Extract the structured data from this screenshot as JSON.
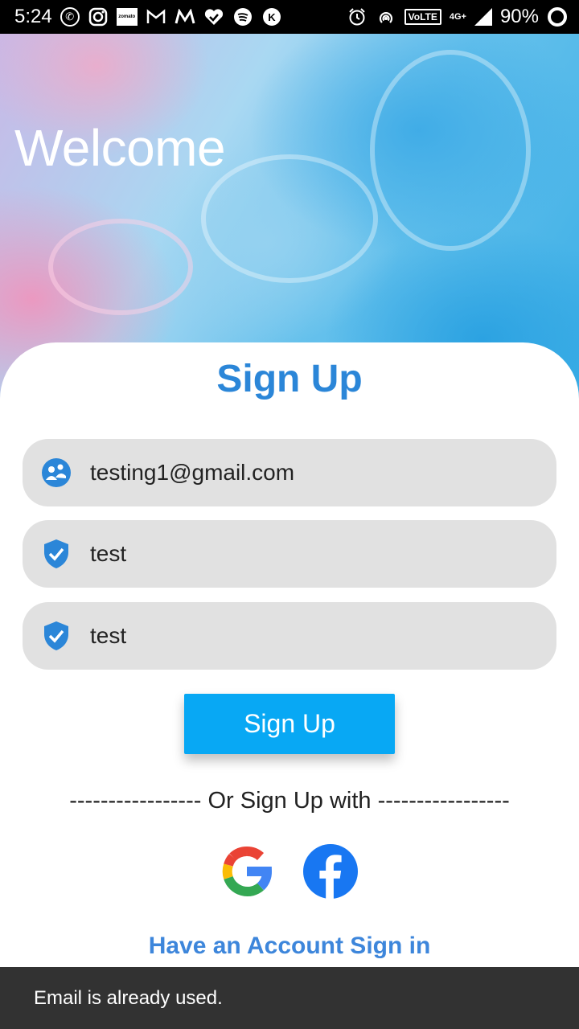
{
  "status_bar": {
    "time": "5:24",
    "volte": "VoLTE",
    "network": "4G+",
    "battery": "90%",
    "left_icons": [
      "whatsapp-icon",
      "instagram-icon",
      "zomato-icon",
      "gmail-icon",
      "medium-icon",
      "heart-check-icon",
      "spotify-icon",
      "kaios-icon"
    ],
    "zomato_text": "zomato"
  },
  "hero": {
    "title": "Welcome"
  },
  "form": {
    "title": "Sign Up",
    "email_value": "testing1@gmail.com",
    "password_value": "test",
    "confirm_value": "test",
    "submit_label": "Sign Up",
    "divider_text": "----------------- Or Sign Up with -----------------",
    "social": [
      "google-icon",
      "facebook-icon"
    ],
    "signin_link": "Have an Account Sign in"
  },
  "snackbar": {
    "message": "Email is already used."
  },
  "colors": {
    "accent_blue": "#2b86d8",
    "button_blue": "#08a8f4",
    "field_gray": "#e1e1e1",
    "snackbar_bg": "#323232"
  }
}
